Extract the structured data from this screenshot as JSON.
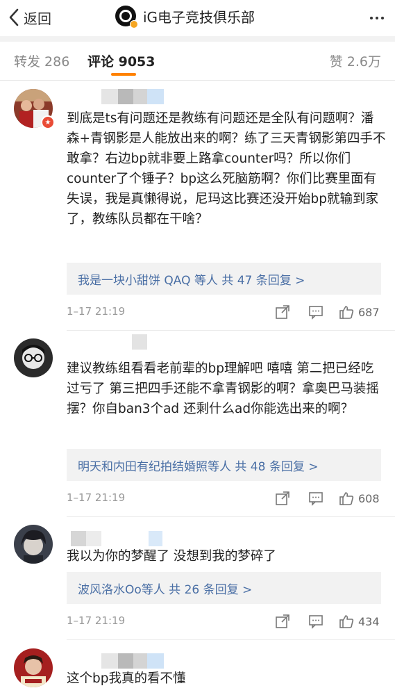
{
  "nav": {
    "back_label": "返回",
    "title": "iG电子竞技俱乐部",
    "more_icon": "more-icon"
  },
  "tabs": {
    "repost": "转发 286",
    "comment": "评论 9053",
    "like": "赞 2.6万",
    "accent": "#ff8200"
  },
  "comments": [
    {
      "text": "到底是ts有问题还是教练有问题还是全队有问题啊？潘森+青钢影是人能放出来的啊？练了三天青钢影第四手不敢拿？右边bp就非要上路拿counter吗？所以你们counter了个锤子？bp这么死脑筋啊？你们比赛里面有失误，我是真懒得说，尼玛这比赛还没开始bp就输到家了，教练队员都在干啥？",
      "replies": "我是一块小甜饼 QAQ 等人  共 47 条回复 >",
      "time": "1–17 21:19",
      "likes": "687"
    },
    {
      "text": "建议教练组看看老前辈的bp理解吧 嘻嘻 第二把已经吃过亏了 第三把四手还能不拿青钢影的啊？拿奥巴马装摇摆？你自ban3个ad 还剩什么ad你能选出来的啊？",
      "replies": "明天和内田有纪拍结婚照等人  共 48 条回复 >",
      "time": "1–17 21:19",
      "likes": "608"
    },
    {
      "text": "我以为你的梦醒了 没想到我的梦碎了",
      "replies": "波风洛水Oo等人  共 26 条回复 >",
      "time": "1–17 21:19",
      "likes": "434"
    },
    {
      "text": "这个bp我真的看不懂"
    }
  ],
  "colors": {
    "reply_link": "#4a6fa5",
    "reply_bg": "#f2f2f2",
    "badge": "#e94b35"
  }
}
